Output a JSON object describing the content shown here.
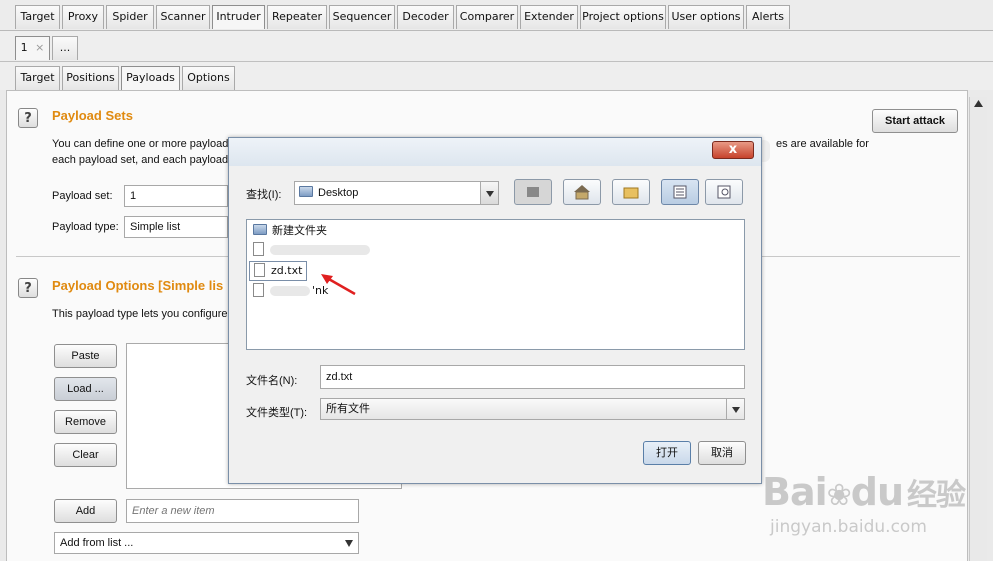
{
  "main_tabs": [
    "Target",
    "Proxy",
    "Spider",
    "Scanner",
    "Intruder",
    "Repeater",
    "Sequencer",
    "Decoder",
    "Comparer",
    "Extender",
    "Project options",
    "User options",
    "Alerts"
  ],
  "main_tab_active": "Intruder",
  "attack_tabs": {
    "first": "1",
    "close": "×",
    "more": "..."
  },
  "sub_tabs": [
    "Target",
    "Positions",
    "Payloads",
    "Options"
  ],
  "sub_tab_active": "Payloads",
  "payload_sets": {
    "help": "?",
    "title": "Payload Sets",
    "desc_line1": "You can define one or more payload",
    "desc_line1_end": "es are available for",
    "desc_line2": "each payload set, and each payload",
    "set_label": "Payload set:",
    "set_value": "1",
    "type_label": "Payload type:",
    "type_value": "Simple list"
  },
  "start_attack": "Start attack",
  "payload_options": {
    "help": "?",
    "title": "Payload Options [Simple lis",
    "desc": "This payload type lets you configure",
    "buttons": {
      "paste": "Paste",
      "load": "Load ...",
      "remove": "Remove",
      "clear": "Clear",
      "add": "Add"
    },
    "add_placeholder": "Enter a new item",
    "add_from_list": "Add from list ..."
  },
  "dialog": {
    "close": "x",
    "look_in_label": "查找(I):",
    "look_in_value": "Desktop",
    "files": [
      "新建文件夹",
      "",
      "zd.txt",
      "'nk"
    ],
    "filename_label": "文件名(N):",
    "filename_value": "zd.txt",
    "filetype_label": "文件类型(T):",
    "filetype_value": "所有文件",
    "open": "打开",
    "cancel": "取消"
  },
  "watermark": {
    "brand": "Bai",
    "brand2": "du",
    "cn": "经验",
    "url": "jingyan.baidu.com"
  },
  "colors": {
    "accent": "#e08a10",
    "arrow": "#e02020"
  },
  "icons": [
    "folder-icon",
    "file-icon",
    "up-folder-icon",
    "home-icon",
    "new-folder-icon",
    "list-view-icon",
    "details-view-icon",
    "dropdown-arrow-icon",
    "scroll-up-arrow-icon"
  ]
}
